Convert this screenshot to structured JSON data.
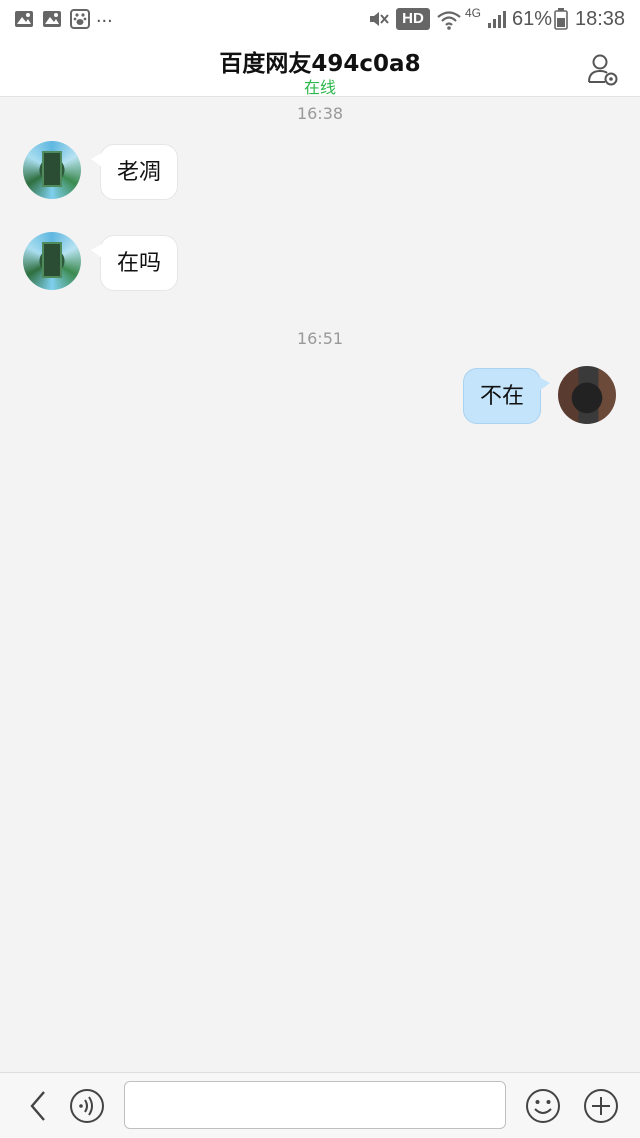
{
  "status_bar": {
    "left_icons": [
      "image-icon",
      "image-icon",
      "baidu-paw-icon"
    ],
    "more": "...",
    "hd": "HD",
    "network": "4G",
    "battery": "61%",
    "time": "18:38"
  },
  "header": {
    "title": "百度网友494c0a8",
    "status": "在线",
    "profile_icon": "user-settings-icon"
  },
  "messages": [
    {
      "timestamp": "16:38"
    },
    {
      "from": "peer",
      "text": "老凋"
    },
    {
      "from": "peer",
      "text": "在吗"
    },
    {
      "timestamp": "16:51"
    },
    {
      "from": "me",
      "text": "不在"
    }
  ],
  "input_bar": {
    "back_icon": "chevron-left-icon",
    "voice_icon": "voice-icon",
    "input_value": "",
    "emoji_icon": "emoji-icon",
    "plus_icon": "plus-circle-icon"
  },
  "colors": {
    "online": "#2db84d",
    "outgoing_bubble": "#c3e4fb",
    "incoming_bubble": "#ffffff",
    "background": "#f3f3f3"
  }
}
